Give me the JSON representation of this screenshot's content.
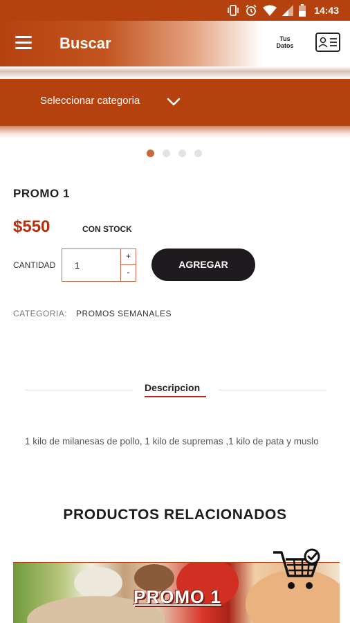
{
  "status_bar": {
    "time": "14:43"
  },
  "header": {
    "title": "Buscar",
    "profile_label": "Tus Datos"
  },
  "category_bar": {
    "label": "Seleccionar categoria"
  },
  "carousel": {
    "count": 4,
    "active_index": 0
  },
  "product": {
    "title": "PROMO 1",
    "price": "$550",
    "stock": "CON STOCK",
    "quantity_label": "CANTIDAD",
    "quantity_value": "1",
    "plus": "+",
    "minus": "-",
    "add_label": "AGREGAR",
    "category_label": "CATEGORIA:",
    "category_value": "PROMOS SEMANALES"
  },
  "tabs": {
    "description_label": "Descripcion"
  },
  "description": {
    "text": "1 kilo de milanesas de pollo, 1 kilo de supremas ,1 kilo de pata y muslo"
  },
  "related": {
    "title": "PRODUCTOS RELACIONADOS",
    "card_label": "PROMO 1"
  },
  "colors": {
    "brand": "#b5410f",
    "price": "#b5300e",
    "button": "#1f1a1e",
    "tab_underline": "#c0261b"
  },
  "icons": [
    "vibrate-icon",
    "alarm-icon",
    "wifi-icon",
    "signal-icon",
    "battery-icon",
    "menu-icon",
    "profile-card-icon",
    "chevron-down-icon",
    "cart-icon"
  ]
}
